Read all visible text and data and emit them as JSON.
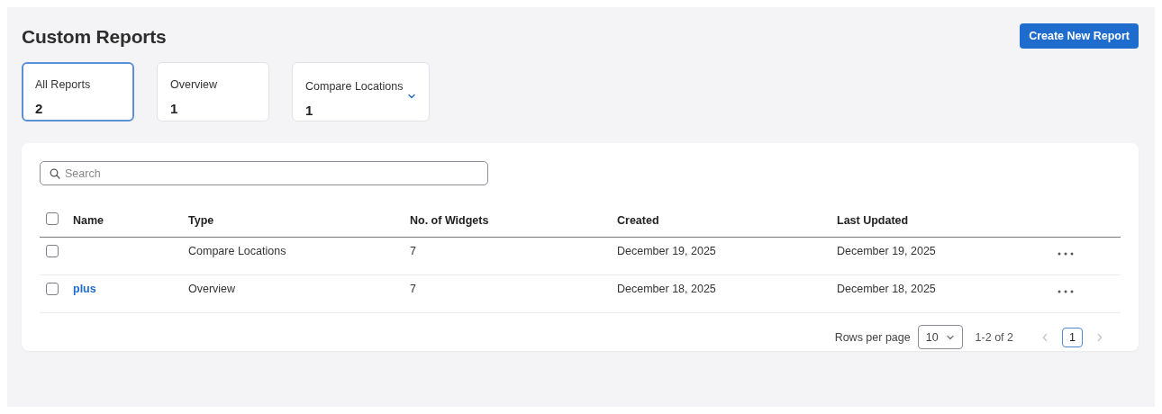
{
  "page": {
    "title": "Custom Reports"
  },
  "create_button": "Create New Report",
  "filters": [
    {
      "label": "All Reports",
      "count": "2",
      "selected": true,
      "dropdown": false
    },
    {
      "label": "Overview",
      "count": "1",
      "selected": false,
      "dropdown": false
    },
    {
      "label": "Compare Locations",
      "count": "1",
      "selected": false,
      "dropdown": true
    }
  ],
  "search": {
    "placeholder": "Search"
  },
  "table": {
    "select_all_checked": false,
    "columns": [
      "Name",
      "Type",
      "No. of Widgets",
      "Created",
      "Last Updated"
    ],
    "rows": [
      {
        "checked": false,
        "type": "Compare Locations",
        "widgets": "7",
        "created": "December 19, 2025",
        "updated": "December 19, 2025"
      },
      {
        "checked": false,
        "name": "plus",
        "type": "Overview",
        "widgets": "7",
        "created": "December 18, 2025",
        "updated": "December 18, 2025"
      }
    ]
  },
  "pagination": {
    "rows_per_page_label": "Rows per page",
    "rows_per_page": "10",
    "range": "1-2 of 2",
    "prev_disabled": true,
    "next_disabled": true,
    "pages": [
      {
        "label": "1",
        "selected": true
      }
    ]
  }
}
